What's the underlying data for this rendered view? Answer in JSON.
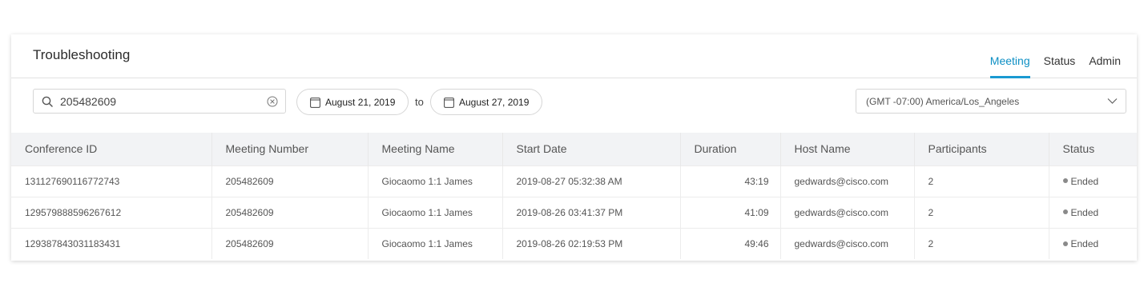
{
  "header": {
    "title": "Troubleshooting",
    "tabs": [
      {
        "label": "Meeting",
        "active": true
      },
      {
        "label": "Status",
        "active": false
      },
      {
        "label": "Admin",
        "active": false
      }
    ]
  },
  "filters": {
    "search_value": "205482609",
    "date_from": "August 21, 2019",
    "to_label": "to",
    "date_to": "August 27, 2019",
    "timezone": "(GMT -07:00) America/Los_Angeles"
  },
  "table": {
    "columns": [
      "Conference ID",
      "Meeting Number",
      "Meeting Name",
      "Start Date",
      "Duration",
      "Host Name",
      "Participants",
      "Status"
    ],
    "rows": [
      [
        "131127690116772743",
        "205482609",
        "Giocaomo 1:1 James",
        "2019-08-27 05:32:38 AM",
        "43:19",
        "gedwards@cisco.com",
        "2",
        "Ended"
      ],
      [
        "129579888596267612",
        "205482609",
        "Giocaomo 1:1 James",
        "2019-08-26 03:41:37 PM",
        "41:09",
        "gedwards@cisco.com",
        "2",
        "Ended"
      ],
      [
        "129387843031183431",
        "205482609",
        "Giocaomo 1:1 James",
        "2019-08-26 02:19:53 PM",
        "49:46",
        "gedwards@cisco.com",
        "2",
        "Ended"
      ]
    ]
  },
  "colors": {
    "accent": "#1a9ad2",
    "header_bg": "#f2f3f5",
    "status_dot": "#8a8a8a"
  },
  "icons": {
    "search": "search-icon",
    "clear": "clear-icon",
    "calendar": "calendar-icon",
    "dropdown": "chevron-down-icon"
  }
}
